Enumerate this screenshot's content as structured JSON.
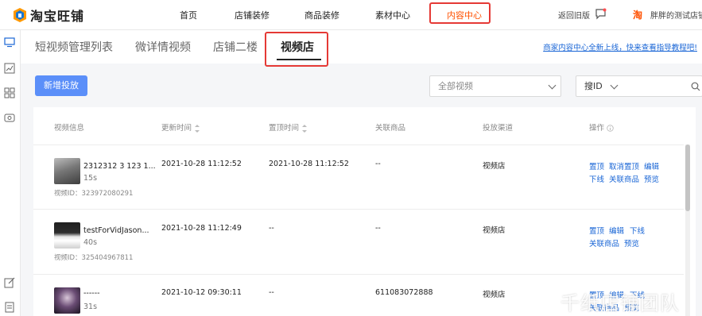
{
  "header": {
    "logo_text": "淘宝旺铺",
    "nav": [
      {
        "label": "首页"
      },
      {
        "label": "店铺装修"
      },
      {
        "label": "商品装修"
      },
      {
        "label": "素材中心"
      },
      {
        "label": "内容中心",
        "active": true
      }
    ],
    "back_old": "返回旧版",
    "shop_badge": "淘",
    "shop_name": "胖胖的测试店铺"
  },
  "sidebar": {
    "icons": [
      "monitor-icon",
      "chart-icon",
      "grid-icon",
      "video-icon",
      "edit-icon",
      "document-icon"
    ]
  },
  "tabs": [
    {
      "label": "短视频管理列表"
    },
    {
      "label": "微详情视频"
    },
    {
      "label": "店铺二楼"
    },
    {
      "label": "视频店",
      "active": true
    }
  ],
  "notice": "商家内容中心全新上线，快来查看指导教程吧!",
  "toolbar": {
    "add_button": "新增投放",
    "filter_select": "全部视频",
    "search_type": "搜ID"
  },
  "table": {
    "headers": [
      "视频信息",
      "更新时间",
      "置顶时间",
      "关联商品",
      "投放渠道",
      "操作"
    ],
    "rows": [
      {
        "title": "2312312 3 123 1...",
        "duration": "15s",
        "video_id": "视频ID：323972080291",
        "update_time": "2021-10-28 11:12:52",
        "pin_time": "2021-10-28 11:12:52",
        "product": "--",
        "channel": "视频店",
        "actions_line1": [
          "置顶",
          "取消置顶",
          "编辑"
        ],
        "actions_line2": [
          "下线",
          "关联商品",
          "预览"
        ]
      },
      {
        "title": "testForVidJason...",
        "duration": "40s",
        "video_id": "视频ID：325404967811",
        "update_time": "2021-10-28 11:12:49",
        "pin_time": "--",
        "product": "--",
        "channel": "视频店",
        "actions_line1": [
          "置顶",
          "编辑",
          "下线"
        ],
        "actions_line2": [
          "关联商品",
          "预览"
        ]
      },
      {
        "title": "------",
        "duration": "31s",
        "update_time": "2021-10-12 09:30:11",
        "pin_time": "--",
        "product": "611083072888",
        "channel": "视频店",
        "actions_line1": [
          "置顶",
          "编辑",
          "下线"
        ],
        "actions_line2": [
          "关联商品",
          "预览"
        ]
      }
    ]
  },
  "watermark": "千纸店铺团队",
  "colors": {
    "accent": "#ff5000",
    "link": "#1a66d6",
    "primary_button": "#5b8ff9",
    "highlight_box": "#e53935"
  }
}
